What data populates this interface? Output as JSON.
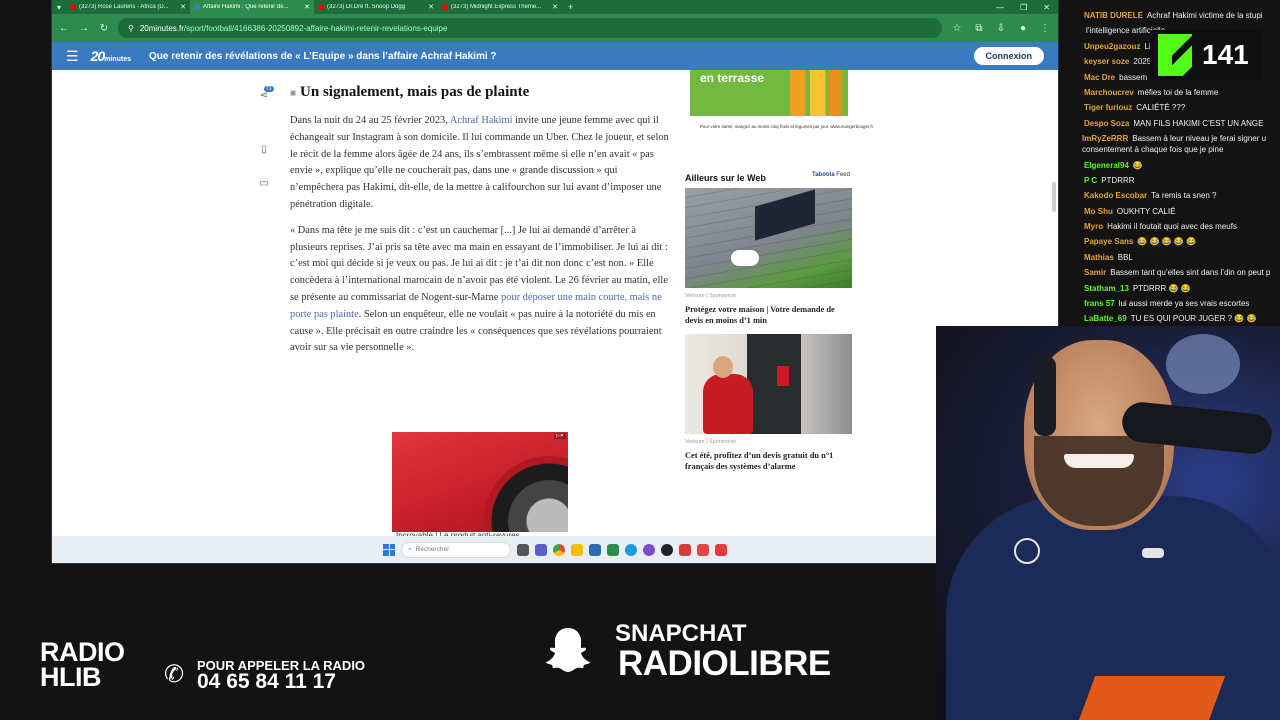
{
  "browser": {
    "tabs": [
      {
        "label": "(3273) Rose Laurens - Africa (D...",
        "favicon": "youtube-icon",
        "active": false
      },
      {
        "label": "Affaire Hakimi : Que retenir de...",
        "favicon": "20minutes-icon",
        "active": true
      },
      {
        "label": "(3273) Dr.Dre ft. Snoop Dogg",
        "favicon": "youtube-icon",
        "active": false
      },
      {
        "label": "(3273) Midnight Express Theme...",
        "favicon": "youtube-icon",
        "active": false
      }
    ],
    "url_host": "20minutes.fr",
    "url_path": "/sport/football/4166386-20250892-affaire-hakimi-retenir-revelations-equipe"
  },
  "site": {
    "logo": "20",
    "logo_small": "minutes",
    "header_title": "Que retenir des révélations de « L’Equipe » dans l’affaire Achraf Hakimi ?",
    "login_label": "Connexion",
    "share_count": "71"
  },
  "article": {
    "heading": "Un signalement, mais pas de plainte",
    "p1_before": "Dans la nuit du 24 au 25 février 2023, ",
    "p1_link": "Achraf Hakimi",
    "p1_after": " invite une jeune femme avec qui il échangeait sur Instagram à son domicile. Il lui commande un Uber. Chez le joueur, et selon le récit de la femme alors âgée de 24 ans, ils s’embrassent même si elle n’en avait « pas envie », explique qu’elle ne coucherait pas, dans une « grande discussion » qui n’empêchera pas Hakimi, dit-elle, de la mettre à califourchon sur lui avant d’imposer une pénétration digitale.",
    "p2_before": "« Dans ma tête je me suis dit : c’est un cauchemar [...] Je lui ai demandé d’arrêter à plusieurs reprises. J’ai pris sa tête avec ma main en essayant de l’immobiliser. Je lui ai dit : c’est moi qui décide si je veux ou pas. Je lui ai dit : je t’ai dit non donc c’est non. » Elle concèdera à l’international marocain de n’avoir pas été violent. Le 26 février au matin, elle se présente au commissariat de Nogent-sur-Marne ",
    "p2_link": "pour déposer une main courte, mais ne porte pas plainte",
    "p2_after": ". Selon un enquêteur, elle ne voulait « pas nuire à la notoriété du mis en cause ». Elle précisait en outre craindre les « conséquences que ses révélations pourraient avoir sur sa vie personnelle ».",
    "ad_bottom_caption": "Incroyable ! Le produit anti-rayures"
  },
  "rail": {
    "ad_top_text": "en terrasse",
    "ad_top_caption": "Pour votre santé, mangez au moins cinq fruits et légumes par jour. www.mangerbouger.fr",
    "web_title": "Ailleurs sur le Web",
    "taboola_brand": "Taboola",
    "taboola_feed": "Feed",
    "item1_source": "Verisure | Sponsorisé",
    "item1_title": "Protégez votre maison | Votre demande de devis en moins d’1 min",
    "item2_source": "Verisure | Sponsorisé",
    "item2_title": "Cet été, profitez d’un devis gratuit du n°1 français des systèmes d’alarme"
  },
  "taskbar": {
    "search_placeholder": "Rechercher"
  },
  "chat": {
    "messages": [
      {
        "user": "NATIB DURELE",
        "text": "Achraf Hakimi victime de la stupi",
        "color": "#e6a23c",
        "wrap": false
      },
      {
        "user": "",
        "text": "l’intelligence artificielle",
        "color": "#f0f0f0",
        "wrap": true
      },
      {
        "user": "Unpeu2gazouz",
        "text": "Lina...",
        "color": "#e6a23c",
        "wrap": false
      },
      {
        "user": "keyser soze",
        "text": "2025",
        "color": "#e6a23c",
        "wrap": false
      },
      {
        "user": "Mac Dre",
        "text": "bassem",
        "color": "#e6a23c",
        "wrap": false
      },
      {
        "user": "Marchoucrev",
        "text": "méfies toi de la femme",
        "color": "#e6a23c",
        "wrap": false
      },
      {
        "user": "Tiger furiouz",
        "text": "CALIÉTÉ ???",
        "color": "#e6a23c",
        "wrap": false
      },
      {
        "user": "Despo Soza",
        "text": "MAN FILS HAKIMI C’EST UN ANGE",
        "color": "#e6a23c",
        "wrap": false
      },
      {
        "user": "ImRyZeRRR",
        "text": "Bassem à leur niveau je ferai signer u consentement à chaque fois que je pine",
        "color": "#e6a23c",
        "wrap": true
      },
      {
        "user": "Elgeneral94",
        "text": "😂",
        "color": "#53fc18",
        "wrap": false
      },
      {
        "user": "P C",
        "text": "PTDRRR",
        "color": "#53fc18",
        "wrap": false
      },
      {
        "user": "Kakodo Escobar",
        "text": "Ta remis ta snen ?",
        "color": "#e6a23c",
        "wrap": false
      },
      {
        "user": "Mo Shu",
        "text": "OUKHTY CALIÉ",
        "color": "#e6a23c",
        "wrap": false
      },
      {
        "user": "Myro",
        "text": "Hakimi il foutait quoi avec des meufs",
        "color": "#e6a23c",
        "wrap": false
      },
      {
        "user": "Papaye Sans",
        "text": "😂 😂 😂 😂 😂",
        "color": "#e6a23c",
        "wrap": false
      },
      {
        "user": "Mathias",
        "text": "BBL",
        "color": "#e6a23c",
        "wrap": false
      },
      {
        "user": "Samir",
        "text": "Bassem tant qu’elles sint dans l’din on peut p",
        "color": "#e6a23c",
        "wrap": false
      },
      {
        "user": "Statham_13",
        "text": "PTDRRR 😂 😂",
        "color": "#53fc18",
        "wrap": false
      },
      {
        "user": "frans 57",
        "text": "lui aussi merde ya ses vrais escortes",
        "color": "#53fc18",
        "wrap": false
      },
      {
        "user": "LaBatte_69",
        "text": "TU ES QUI POUR JUGER ? 😂 😂",
        "color": "#53fc18",
        "wrap": false
      }
    ]
  },
  "stream": {
    "viewer_count": "141"
  },
  "banner": {
    "radio_line1": "RADIO",
    "radio_line2": "HLIB",
    "phone_label": "POUR APPELER LA RADIO",
    "phone_number": "04 65 84 11 17",
    "snap_label": "SNAPCHAT",
    "snap_handle": "RADIOLIBRE"
  }
}
